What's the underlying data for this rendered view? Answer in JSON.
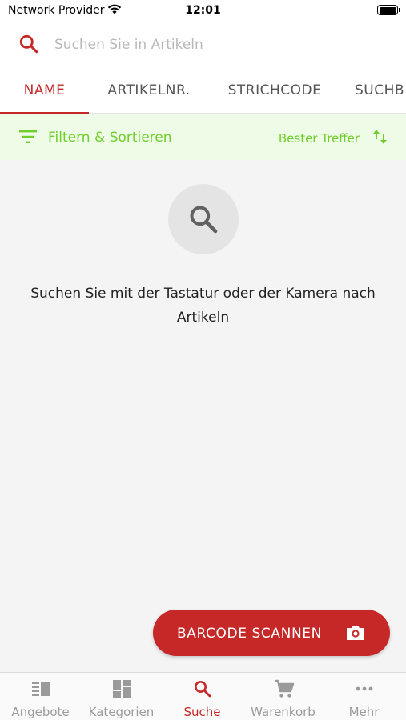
{
  "status_bar": {
    "carrier": "Network Provider",
    "time": "12:01"
  },
  "search": {
    "placeholder": "Suchen Sie in Artikeln",
    "value": ""
  },
  "tabs": [
    {
      "label": "NAME",
      "active": true
    },
    {
      "label": "ARTIKELNR.",
      "active": false
    },
    {
      "label": "STRICHCODE",
      "active": false
    },
    {
      "label": "SUCHB",
      "active": false
    }
  ],
  "filter": {
    "label": "Filtern & Sortieren",
    "sort_label": "Bester Treffer"
  },
  "empty_state": {
    "message": "Suchen Sie mit der Tastatur oder der Kamera nach Artikeln"
  },
  "barcode_button": {
    "label": "BARCODE SCANNEN"
  },
  "bottom_nav": [
    {
      "label": "Angebote",
      "icon": "offers-icon",
      "active": false
    },
    {
      "label": "Kategorien",
      "icon": "categories-icon",
      "active": false
    },
    {
      "label": "Suche",
      "icon": "search-icon",
      "active": true
    },
    {
      "label": "Warenkorb",
      "icon": "cart-icon",
      "active": false
    },
    {
      "label": "Mehr",
      "icon": "more-icon",
      "active": false
    }
  ],
  "colors": {
    "accent": "#c62828",
    "filter_bg": "#eefbe6",
    "filter_text": "#6fcf2a",
    "background": "#f4f4f4"
  }
}
